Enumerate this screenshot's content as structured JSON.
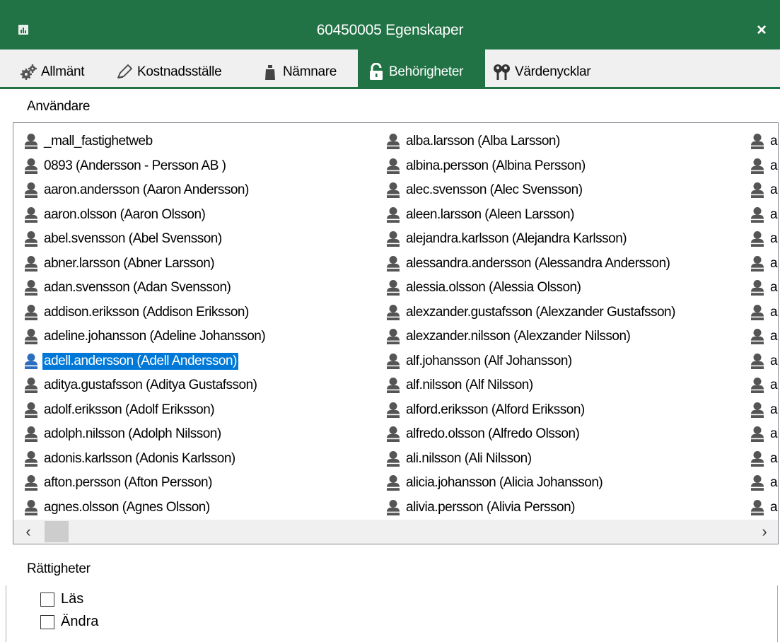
{
  "window": {
    "title": "60450005 Egenskaper",
    "close_label": "×"
  },
  "tabs": [
    {
      "label": "Allmänt",
      "icon": "gears-icon"
    },
    {
      "label": "Kostnadsställe",
      "icon": "pencil-icon"
    },
    {
      "label": "Nämnare",
      "icon": "weight-icon"
    },
    {
      "label": "Behörigheter",
      "icon": "lock-icon",
      "active": true
    },
    {
      "label": "Värdenycklar",
      "icon": "keys-icon"
    }
  ],
  "users_section": {
    "label": "Användare",
    "columns": [
      [
        "_mall_fastighetweb",
        "0893 (Andersson - Persson AB )",
        "aaron.andersson (Aaron Andersson)",
        "aaron.olsson (Aaron Olsson)",
        "abel.svensson (Abel Svensson)",
        "abner.larsson (Abner Larsson)",
        "adan.svensson (Adan Svensson)",
        "addison.eriksson (Addison Eriksson)",
        "adeline.johansson (Adeline Johansson)",
        "adell.andersson (Adell Andersson)",
        "aditya.gustafsson (Aditya Gustafsson)",
        "adolf.eriksson (Adolf Eriksson)",
        "adolph.nilsson (Adolph Nilsson)",
        "adonis.karlsson (Adonis Karlsson)",
        "afton.persson (Afton Persson)",
        "agnes.olsson (Agnes Olsson)"
      ],
      [
        "alba.larsson (Alba Larsson)",
        "albina.persson (Albina Persson)",
        "alec.svensson (Alec Svensson)",
        "aleen.larsson (Aleen Larsson)",
        "alejandra.karlsson (Alejandra Karlsson)",
        "alessandra.andersson (Alessandra Andersson)",
        "alessia.olsson (Alessia Olsson)",
        "alexzander.gustafsson (Alexzander Gustafsson)",
        "alexzander.nilsson (Alexzander Nilsson)",
        "alf.johansson (Alf Johansson)",
        "alf.nilsson (Alf Nilsson)",
        "alford.eriksson (Alford Eriksson)",
        "alfredo.olsson (Alfredo Olsson)",
        "ali.nilsson (Ali Nilsson)",
        "alicia.johansson (Alicia Johansson)",
        "alivia.persson (Alivia Persson)"
      ],
      [
        "a",
        "a",
        "a",
        "a",
        "a",
        "a",
        "a",
        "a",
        "a",
        "a",
        "a",
        "a",
        "a",
        "a",
        "a",
        "a"
      ]
    ],
    "selected_user": "adell.andersson (Adell Andersson)",
    "scroll_left": "‹",
    "scroll_right": "›"
  },
  "rights_section": {
    "label": "Rättigheter",
    "options": [
      {
        "label": "Läs",
        "checked": false
      },
      {
        "label": "Ändra",
        "checked": false
      }
    ]
  },
  "colors": {
    "accent": "#217346",
    "selection": "#0078d7",
    "user_icon": "#555555",
    "user_icon_selected": "#2a6ebd"
  }
}
